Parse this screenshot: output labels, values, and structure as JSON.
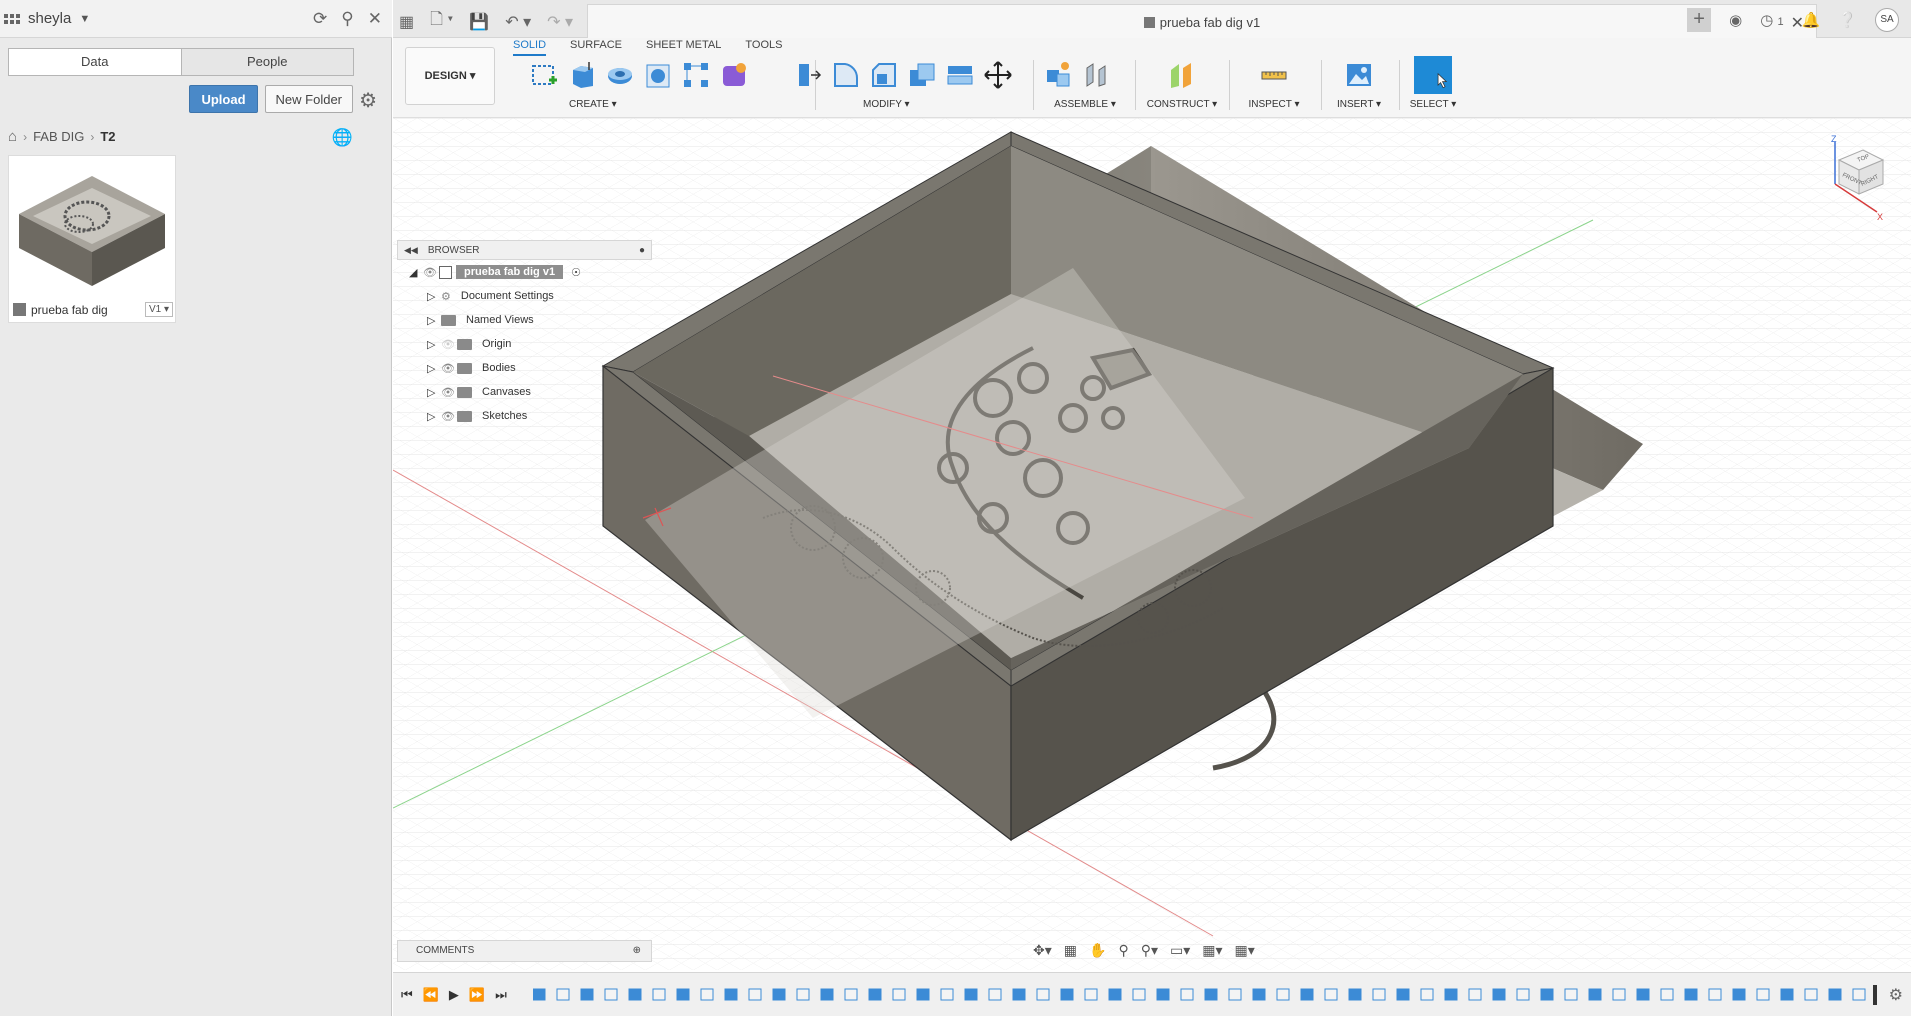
{
  "data_panel": {
    "user": "sheyla",
    "tabs": [
      "Data",
      "People"
    ],
    "upload_label": "Upload",
    "new_folder_label": "New Folder",
    "breadcrumb": [
      "FAB DIG",
      "T2"
    ],
    "file": {
      "name": "prueba fab dig",
      "version": "V1 ▾"
    }
  },
  "document": {
    "title": "prueba fab dig v1"
  },
  "titlebar_right": {
    "notifications": "1",
    "avatar": "SA"
  },
  "ribbon": {
    "workspace": "DESIGN ▾",
    "tabs": [
      "SOLID",
      "SURFACE",
      "SHEET METAL",
      "TOOLS"
    ],
    "groups": [
      "CREATE ▾",
      "MODIFY ▾",
      "ASSEMBLE ▾",
      "CONSTRUCT ▾",
      "INSPECT ▾",
      "INSERT ▾",
      "SELECT ▾"
    ]
  },
  "browser": {
    "header": "BROWSER",
    "root": "prueba fab dig v1",
    "items": [
      "Document Settings",
      "Named Views",
      "Origin",
      "Bodies",
      "Canvases",
      "Sketches"
    ]
  },
  "comments": {
    "label": "COMMENTS"
  },
  "viewcube": {
    "top": "TOP",
    "front": "FRONT",
    "right": "RIGHT",
    "z": "Z",
    "x": "X"
  },
  "colors": {
    "accent": "#1e7ac9",
    "upload": "#4a89c8",
    "box_face": "#6f6b63",
    "box_dark": "#4e4b45"
  }
}
